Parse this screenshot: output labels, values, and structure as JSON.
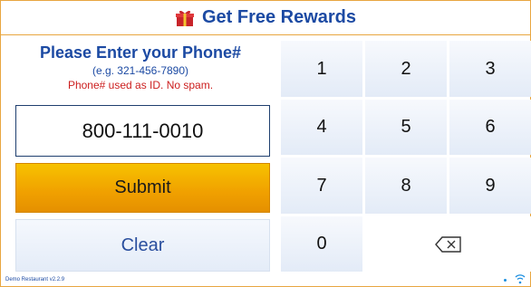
{
  "header": {
    "title": "Get Free Rewards",
    "icon": "gift-icon"
  },
  "prompt": {
    "title": "Please Enter your Phone#",
    "example": "(e.g. 321-456-7890)",
    "note": "Phone# used as ID. No spam."
  },
  "phone_value": "800-111-0010",
  "buttons": {
    "submit": "Submit",
    "clear": "Clear"
  },
  "keypad": {
    "keys": [
      "1",
      "2",
      "3",
      "4",
      "5",
      "6",
      "7",
      "8",
      "9",
      "0"
    ],
    "backspace_icon": "backspace-icon"
  },
  "footer": {
    "version": "Demo Restaurant v2.2.9",
    "status_icon": "wifi-icon"
  },
  "colors": {
    "accent_blue": "#1c4aa3",
    "note_red": "#cc1e1e",
    "submit_orange": "#f0a000",
    "border_orange": "#e8a640"
  }
}
